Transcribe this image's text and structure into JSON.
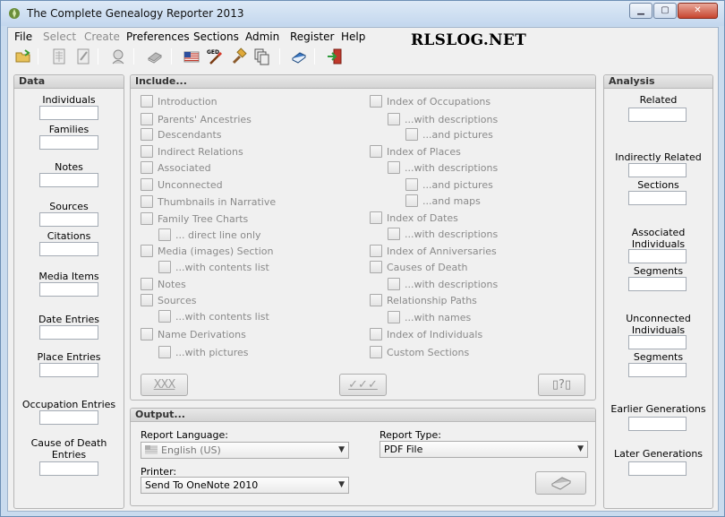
{
  "window": {
    "title": "The Complete Genealogy Reporter 2013"
  },
  "menu": [
    {
      "label": "File",
      "enabled": true
    },
    {
      "label": "Select",
      "enabled": false
    },
    {
      "label": "Create",
      "enabled": false
    },
    {
      "label": "Preferences",
      "enabled": true
    },
    {
      "label": "Sections",
      "enabled": true
    },
    {
      "label": "Admin",
      "enabled": true
    },
    {
      "label": "Register",
      "enabled": true
    },
    {
      "label": "Help",
      "enabled": true
    }
  ],
  "watermark": "RLSLOG.NET",
  "toolbar": {
    "icons": [
      "open-folder-icon",
      "document-grid-icon",
      "document-edit-icon",
      "person-head-icon",
      "book-gray-icon",
      "us-flag-icon",
      "gedcom-wand-icon",
      "hammer-icon",
      "document-stack-icon",
      "book-blue-icon",
      "exit-door-icon"
    ]
  },
  "data_panel": {
    "title": "Data",
    "fields": [
      "Individuals",
      "Families",
      "Notes",
      "Sources",
      "Citations",
      "Media Items",
      "Date Entries",
      "Place Entries",
      "Occupation Entries",
      "Cause of Death\nEntries"
    ]
  },
  "include_panel": {
    "title": "Include...",
    "left": [
      {
        "label": "Introduction"
      },
      {
        "label": "Parents' Ancestries"
      },
      {
        "label": "Descendants"
      },
      {
        "label": "Indirect Relations"
      },
      {
        "label": "Associated"
      },
      {
        "label": "Unconnected"
      },
      {
        "label": "Thumbnails in Narrative"
      },
      {
        "label": "Family Tree Charts"
      },
      {
        "label": "... direct line only"
      },
      {
        "label": "Media (images) Section"
      },
      {
        "label": "...with contents list"
      },
      {
        "label": "Notes"
      },
      {
        "label": "Sources"
      },
      {
        "label": "...with contents list"
      },
      {
        "label": "Name Derivations"
      },
      {
        "label": "...with pictures"
      }
    ],
    "right": [
      {
        "label": "Index of Occupations"
      },
      {
        "label": "...with descriptions"
      },
      {
        "label": "...and pictures"
      },
      {
        "label": "Index of Places"
      },
      {
        "label": "...with descriptions"
      },
      {
        "label": "...and pictures"
      },
      {
        "label": "...and maps"
      },
      {
        "label": "Index of Dates"
      },
      {
        "label": "...with descriptions"
      },
      {
        "label": "Index of Anniversaries"
      },
      {
        "label": "Causes of Death"
      },
      {
        "label": "...with descriptions"
      },
      {
        "label": "Relationship Paths"
      },
      {
        "label": "...with names"
      },
      {
        "label": "Index of Individuals"
      },
      {
        "label": "Custom Sections"
      }
    ],
    "buttons": [
      "XXX",
      "✓✓✓",
      "▯?▯"
    ]
  },
  "output_panel": {
    "title": "Output...",
    "report_language_label": "Report Language:",
    "report_language_value": "English (US)",
    "report_type_label": "Report Type:",
    "report_type_value": "PDF File",
    "printer_label": "Printer:",
    "printer_value": "Send To OneNote 2010"
  },
  "analysis_panel": {
    "title": "Analysis",
    "fields": [
      "Related",
      "Indirectly Related",
      "Sections",
      "Associated\nIndividuals",
      "Segments",
      "Unconnected\nIndividuals",
      "Segments",
      "Earlier Generations",
      "Later Generations"
    ]
  }
}
